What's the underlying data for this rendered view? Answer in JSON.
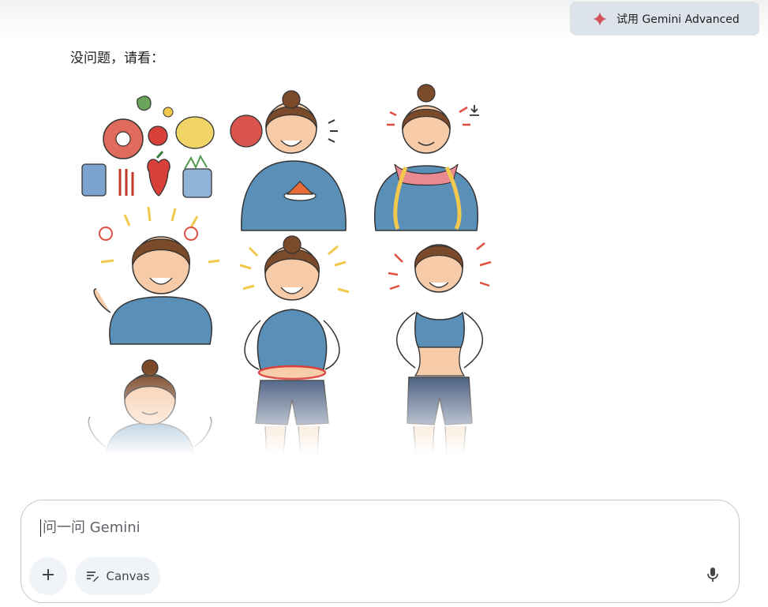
{
  "header": {
    "advanced_button_label": "试用 Gemini Advanced",
    "advanced_icon": "gemini-sparkle-icon",
    "accent_color": "#d6515f"
  },
  "response": {
    "text": "没问题，请看：",
    "download_icon": "download-icon"
  },
  "composer": {
    "placeholder": "问一问 Gemini",
    "add_icon": "plus-icon",
    "canvas_label": "Canvas",
    "canvas_icon": "canvas-icon",
    "mic_icon": "mic-icon"
  }
}
